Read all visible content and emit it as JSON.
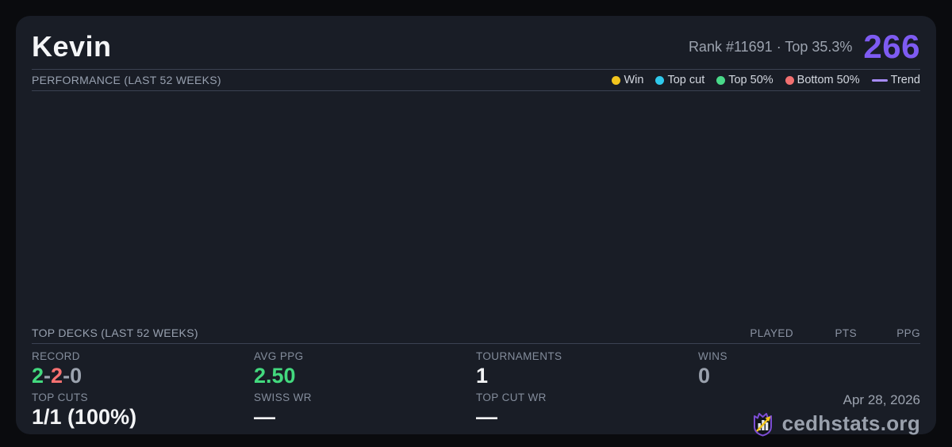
{
  "page": {
    "background": "#0a0b0e",
    "card_background": "#191d26",
    "accent": "#7e5bf2"
  },
  "header": {
    "player_name": "Kevin",
    "rank_summary": "Rank #11691 · Top 35.3%",
    "score": "266",
    "score_color": "#7e5bf2"
  },
  "performance": {
    "title": "PERFORMANCE (LAST 52 WEEKS)",
    "legend": [
      {
        "label": "Win",
        "color": "#f2c51d",
        "swatch": "dot"
      },
      {
        "label": "Top cut",
        "color": "#2fc9ec",
        "swatch": "dot"
      },
      {
        "label": "Top 50%",
        "color": "#49d989",
        "swatch": "dot"
      },
      {
        "label": "Bottom 50%",
        "color": "#f27070",
        "swatch": "dot"
      },
      {
        "label": "Trend",
        "color": "#a78bfa",
        "swatch": "line"
      }
    ]
  },
  "top_decks": {
    "title": "TOP DECKS (LAST 52 WEEKS)",
    "columns": [
      "PLAYED",
      "PTS",
      "PPG"
    ],
    "rows": []
  },
  "stats": {
    "record": {
      "label": "RECORD",
      "wins": "2",
      "losses": "2",
      "draws": "0",
      "separator": "-",
      "win_color": "#43d97e",
      "loss_color": "#f87171",
      "draw_color": "#9ca3af"
    },
    "avg_ppg": {
      "label": "AVG PPG",
      "value": "2.50",
      "color": "#43d97e"
    },
    "tournaments": {
      "label": "TOURNAMENTS",
      "value": "1"
    },
    "wins": {
      "label": "WINS",
      "value": "0"
    },
    "top_cuts": {
      "label": "TOP CUTS",
      "value": "1/1 (100%)"
    },
    "swiss_wr": {
      "label": "SWISS WR",
      "value": "—"
    },
    "top_cut_wr": {
      "label": "TOP CUT WR",
      "value": "—"
    }
  },
  "footer": {
    "date": "Apr 28, 2026",
    "brand": "cedhstats.org",
    "logo": "shield-bar-chart-arrow-icon"
  }
}
